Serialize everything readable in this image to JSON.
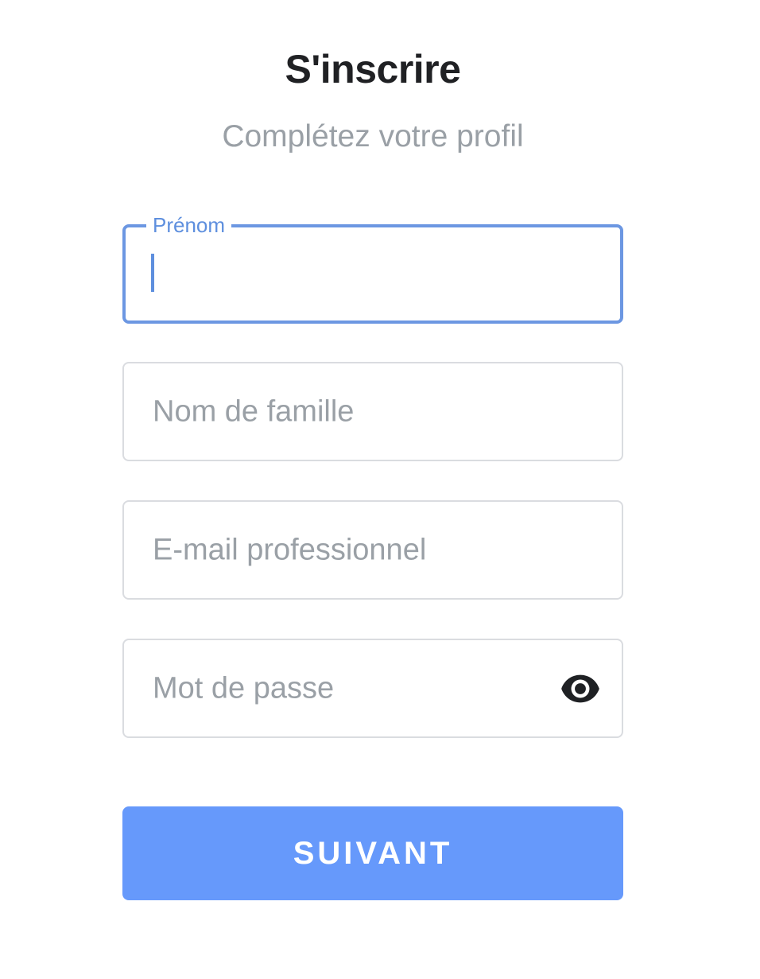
{
  "header": {
    "title": "S'inscrire",
    "subtitle": "Complétez votre profil"
  },
  "form": {
    "first_name": {
      "label": "Prénom",
      "value": ""
    },
    "last_name": {
      "placeholder": "Nom de famille"
    },
    "email": {
      "placeholder": "E-mail professionnel"
    },
    "password": {
      "placeholder": "Mot de passe",
      "toggle_icon": "eye-icon"
    },
    "submit_label": "SUIVANT"
  },
  "colors": {
    "accent": "#6699fb",
    "focus_border": "#6c97e2",
    "title": "#202124",
    "muted": "#9aa0a6",
    "border": "#dadce0"
  }
}
